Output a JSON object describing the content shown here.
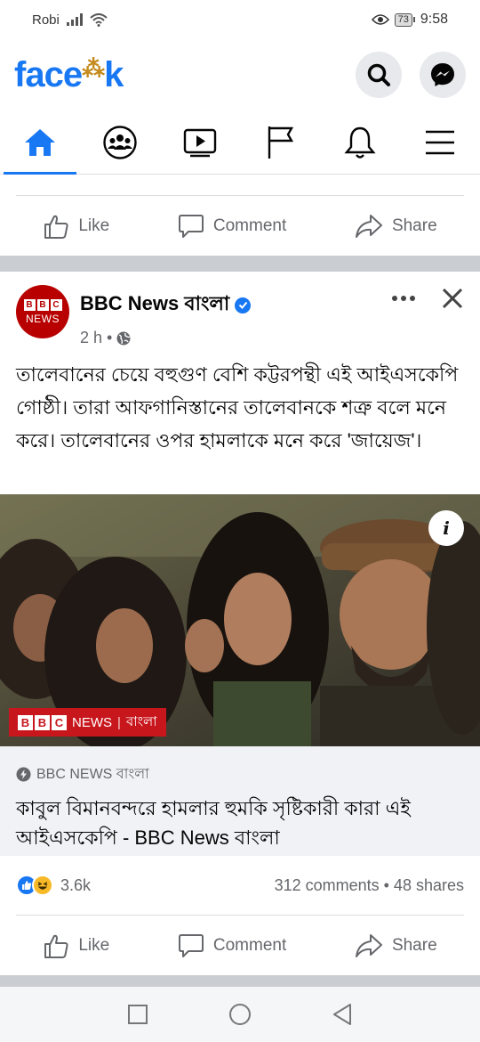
{
  "status_bar": {
    "carrier": "Robi",
    "battery": "73",
    "time": "9:58"
  },
  "header": {
    "logo_text_left": "face",
    "logo_text_right": "k",
    "search_icon": "search-icon",
    "messenger_icon": "messenger-icon"
  },
  "nav": {
    "tabs": [
      "home-icon",
      "groups-icon",
      "watch-icon",
      "pages-icon",
      "notifications-icon",
      "menu-icon"
    ],
    "active": "home"
  },
  "prev_post_actions": {
    "like": "Like",
    "comment": "Comment",
    "share": "Share"
  },
  "post": {
    "avatar_top": "BBC",
    "avatar_bottom": "NEWS",
    "page_name": "BBC News বাংলা",
    "time": "2 h",
    "separator": "•",
    "text": "তালেবানের চেয়ে বহুগুণ বেশি কট্টরপন্থী এই আইএসকেপি গোষ্ঠী। তারা আফগানিস্তানের তালেবানকে শত্রু বলে মনে করে। তালেবানের ওপর হামলাকে মনে করে 'জায়েজ'।",
    "image_watermark_news": "NEWS",
    "image_watermark_lang": "বাংলা",
    "info_label": "i",
    "link_source": "BBC NEWS বাংলা",
    "link_title": "কাবুল বিমানবন্দরে হামলার হুমকি সৃষ্টিকারী কারা এই আইএসকেপি - BBC News বাংলা",
    "reaction_count": "3.6k",
    "stats": "312 comments • 48 shares",
    "actions": {
      "like": "Like",
      "comment": "Comment",
      "share": "Share"
    }
  },
  "colors": {
    "brand": "#1877f2",
    "bbc_red": "#b80000",
    "muted": "#65676b"
  }
}
